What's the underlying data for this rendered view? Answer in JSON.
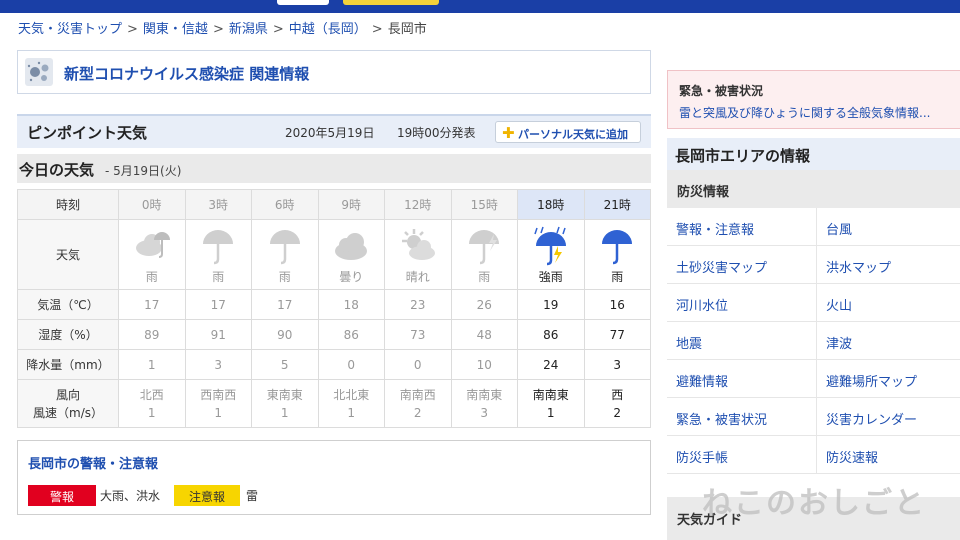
{
  "breadcrumb": [
    {
      "label": "天気・災害トップ",
      "link": true
    },
    {
      "label": "関東・信越",
      "link": true
    },
    {
      "label": "新潟県",
      "link": true
    },
    {
      "label": "中越（長岡）",
      "link": true
    },
    {
      "label": "長岡市",
      "link": false
    }
  ],
  "covid": {
    "title": "新型コロナウイルス感染症 関連情報"
  },
  "pinpoint": {
    "title": "ピンポイント天気",
    "date": "2020年5月19日",
    "time": "19時00分発表",
    "add_label": "パーソナル天気に追加"
  },
  "today": {
    "title": "今日の天気",
    "date": "- 5月19日(火)"
  },
  "table": {
    "labels": {
      "time": "時刻",
      "weather": "天気",
      "temp": "気温（℃）",
      "humidity": "湿度（%）",
      "precip": "降水量（mm）",
      "wind_dir": "風向",
      "wind_speed": "風速（m/s）"
    },
    "hours": [
      "0時",
      "3時",
      "6時",
      "9時",
      "12時",
      "15時",
      "18時",
      "21時"
    ],
    "weather": [
      "雨",
      "雨",
      "雨",
      "曇り",
      "晴れ",
      "雨",
      "強雨",
      "雨"
    ],
    "icons": [
      "cloud-umbrella-icon",
      "umbrella-icon",
      "umbrella-icon",
      "cloud-icon",
      "sun-cloud-icon",
      "umbrella-icon",
      "heavy-rain-icon",
      "umbrella-icon"
    ],
    "temp": [
      "17",
      "17",
      "17",
      "18",
      "23",
      "26",
      "19",
      "16"
    ],
    "humidity": [
      "89",
      "91",
      "90",
      "86",
      "73",
      "48",
      "86",
      "77"
    ],
    "precip": [
      "1",
      "3",
      "5",
      "0",
      "0",
      "10",
      "24",
      "3"
    ],
    "wind_dir": [
      "北西",
      "西南西",
      "東南東",
      "北北東",
      "南南西",
      "南南東",
      "南南東",
      "西"
    ],
    "wind_speed": [
      "1",
      "1",
      "1",
      "1",
      "2",
      "3",
      "1",
      "2"
    ]
  },
  "warnings": {
    "title": "長岡市の警報・注意報",
    "warning_label": "警報",
    "warning_items": "大雨、洪水",
    "advisory_label": "注意報",
    "advisory_items": "雷"
  },
  "alert": {
    "title": "緊急・被害状況",
    "text": "雷と突風及び降ひょうに関する全般気象情報..."
  },
  "area": {
    "title": "長岡市エリアの情報",
    "bosai_title": "防災情報",
    "links": [
      "警報・注意報",
      "台風",
      "土砂災害マップ",
      "洪水マップ",
      "河川水位",
      "火山",
      "地震",
      "津波",
      "避難情報",
      "避難場所マップ",
      "緊急・被害状況",
      "災害カレンダー",
      "防災手帳",
      "防災速報"
    ],
    "guide_title": "天気ガイド"
  },
  "watermark": "ねこのおしごと",
  "colors": {
    "accent_blue": "#1f4fb0",
    "topbar": "#1a3fa6",
    "warning_red": "#e1001f",
    "advisory_yellow": "#f7d500",
    "highlight_col": "#dde6f7"
  }
}
